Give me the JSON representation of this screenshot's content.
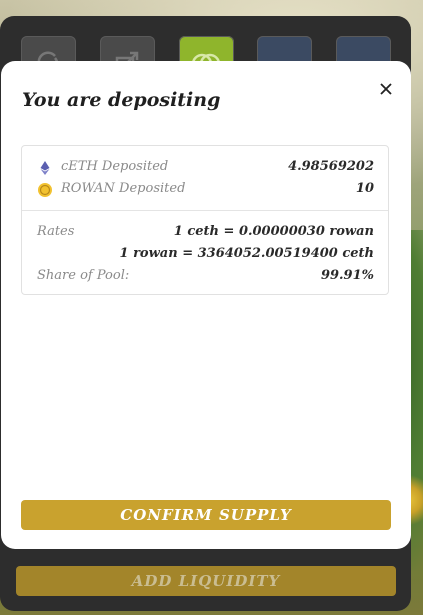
{
  "background_nav": {
    "buttons": [
      {
        "icon": "swap-icon"
      },
      {
        "icon": "export-icon"
      },
      {
        "icon": "pool-rings-icon",
        "active": true
      },
      {
        "icon": "blank-icon"
      },
      {
        "icon": "blank-icon"
      }
    ],
    "add_liquidity_label": "ADD LIQUIDITY"
  },
  "modal": {
    "title": "You are depositing",
    "close_icon": "close-icon",
    "deposits": [
      {
        "icon": "ethereum-icon",
        "label": "cETH Deposited",
        "value": "4.98569202"
      },
      {
        "icon": "rowan-coin-icon",
        "label": "ROWAN Deposited",
        "value": "10"
      }
    ],
    "rates_label": "Rates",
    "rate_1": "1 ceth = 0.00000030 rowan",
    "rate_2": "1 rowan = 3364052.00519400 ceth",
    "share_label": "Share of Pool:",
    "share_value": "99.91%",
    "confirm_label": "CONFIRM SUPPLY"
  },
  "colors": {
    "accent_gold": "#c9a22e",
    "active_green": "#8fb52c",
    "panel_dark": "#2d2d2d"
  }
}
